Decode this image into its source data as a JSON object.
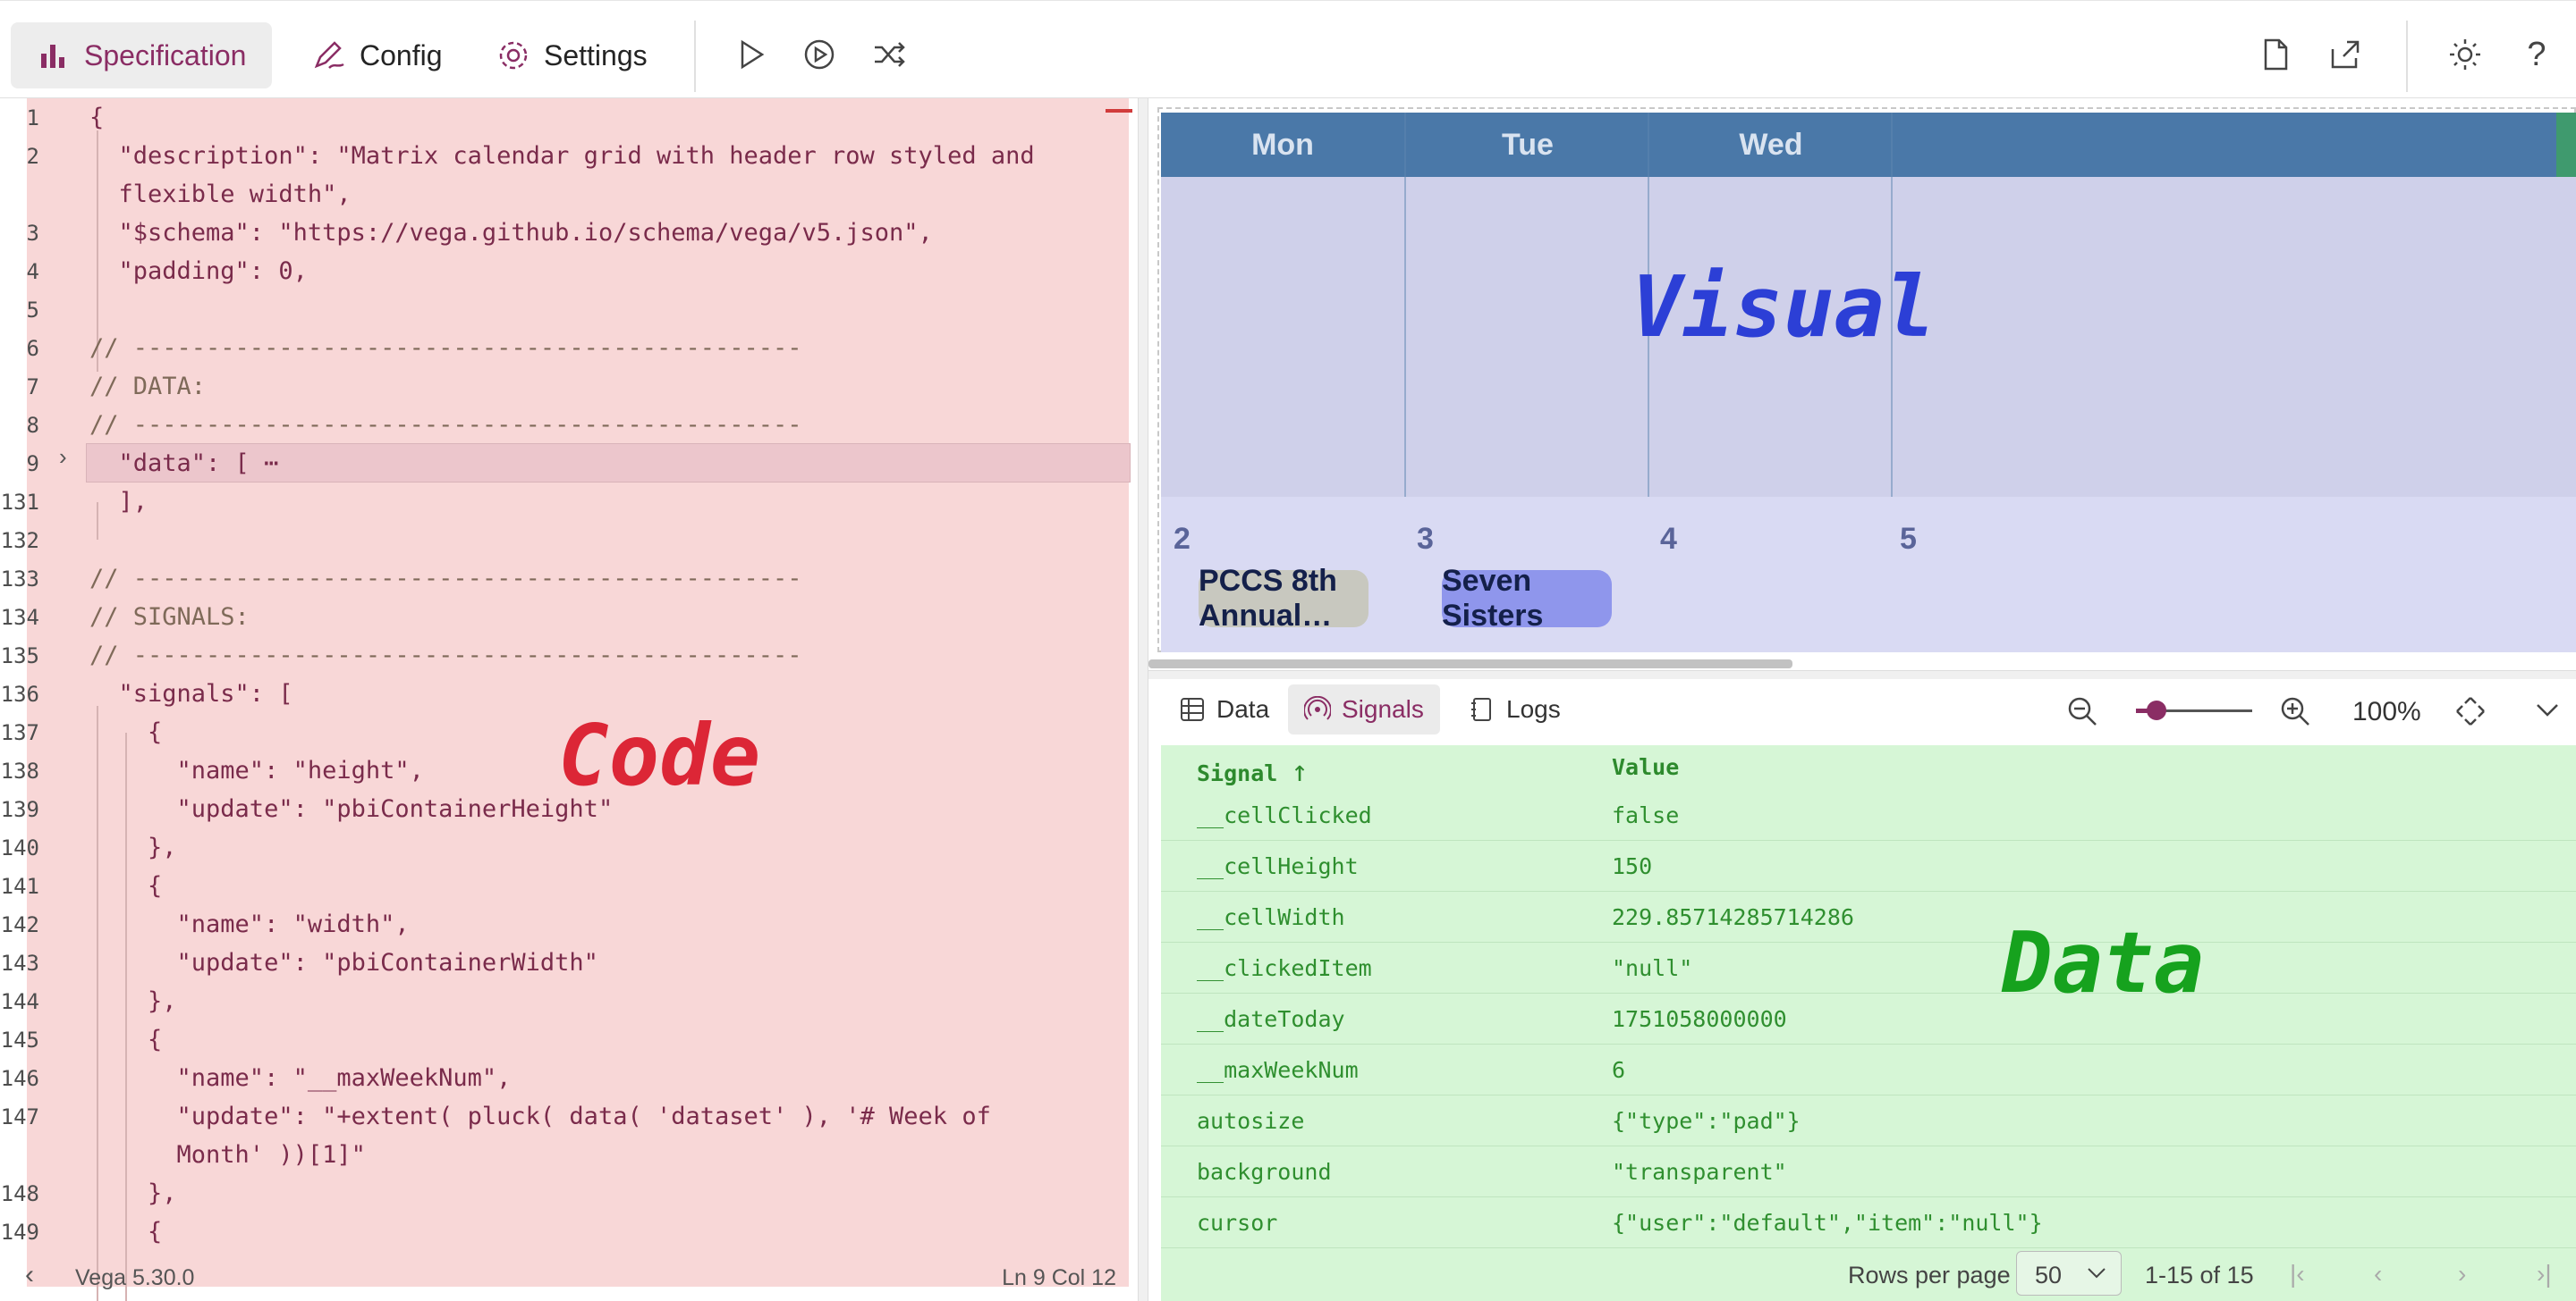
{
  "toolbar": {
    "tabs": [
      {
        "label": "Specification",
        "icon": "bar-chart-icon",
        "active": true
      },
      {
        "label": "Config",
        "icon": "pen-icon",
        "active": false
      },
      {
        "label": "Settings",
        "icon": "gear-icon",
        "active": false
      }
    ],
    "actions": [
      "play-icon",
      "replay-icon",
      "shuffle-icon"
    ],
    "right_actions": [
      "new-file-icon",
      "share-icon",
      "theme-sun-icon",
      "help-icon"
    ],
    "help_glyph": "?"
  },
  "editor": {
    "lines": [
      {
        "n": "1",
        "text": "{"
      },
      {
        "n": "2",
        "text": "  \"description\": \"Matrix calendar grid with header row styled and"
      },
      {
        "n": "",
        "text": "  flexible width\","
      },
      {
        "n": "3",
        "text": "  \"$schema\": \"https://vega.github.io/schema/vega/v5.json\","
      },
      {
        "n": "4",
        "text": "  \"padding\": 0,"
      },
      {
        "n": "5",
        "text": ""
      },
      {
        "n": "6",
        "text": "// ----------------------------------------------"
      },
      {
        "n": "7",
        "text": "// DATA:"
      },
      {
        "n": "8",
        "text": "// ----------------------------------------------"
      },
      {
        "n": "9",
        "text": "  \"data\": [ ⋯"
      },
      {
        "n": "131",
        "text": "  ],"
      },
      {
        "n": "132",
        "text": ""
      },
      {
        "n": "133",
        "text": "// ----------------------------------------------"
      },
      {
        "n": "134",
        "text": "// SIGNALS:"
      },
      {
        "n": "135",
        "text": "// ----------------------------------------------"
      },
      {
        "n": "136",
        "text": "  \"signals\": ["
      },
      {
        "n": "137",
        "text": "    {"
      },
      {
        "n": "138",
        "text": "      \"name\": \"height\","
      },
      {
        "n": "139",
        "text": "      \"update\": \"pbiContainerHeight\""
      },
      {
        "n": "140",
        "text": "    },"
      },
      {
        "n": "141",
        "text": "    {"
      },
      {
        "n": "142",
        "text": "      \"name\": \"width\","
      },
      {
        "n": "143",
        "text": "      \"update\": \"pbiContainerWidth\""
      },
      {
        "n": "144",
        "text": "    },"
      },
      {
        "n": "145",
        "text": "    {"
      },
      {
        "n": "146",
        "text": "      \"name\": \"__maxWeekNum\","
      },
      {
        "n": "147",
        "text": "      \"update\": \"+extent( pluck( data( 'dataset' ), '# Week of"
      },
      {
        "n": "",
        "text": "      Month' ))[1]\""
      },
      {
        "n": "148",
        "text": "    },"
      },
      {
        "n": "149",
        "text": "    {"
      }
    ],
    "overlay_label": "Code",
    "status": {
      "version": "Vega 5.30.0",
      "position": "Ln 9 Col 12"
    }
  },
  "visual": {
    "days": [
      "Mon",
      "Tue",
      "Wed"
    ],
    "dates": [
      "2",
      "3",
      "4",
      "5"
    ],
    "events": [
      "PCCS 8th Annual…",
      "Seven Sisters"
    ],
    "overlay_label": "Visual",
    "colors": {
      "header": "#4a78a8",
      "cell": "#cfd0ea",
      "event1": "#c8c8bf",
      "event2": "#8f96ec"
    }
  },
  "data_panel": {
    "tabs": [
      {
        "label": "Data",
        "icon": "table-icon"
      },
      {
        "label": "Signals",
        "icon": "signal-icon",
        "active": true
      },
      {
        "label": "Logs",
        "icon": "log-icon"
      }
    ],
    "zoom": "100%",
    "columns": {
      "signal": "Signal",
      "sort_glyph": "↑",
      "value": "Value"
    },
    "rows": [
      {
        "signal": "__cellClicked",
        "value": "false"
      },
      {
        "signal": "__cellHeight",
        "value": "150"
      },
      {
        "signal": "__cellWidth",
        "value": "229.85714285714286"
      },
      {
        "signal": "__clickedItem",
        "value": "\"null\""
      },
      {
        "signal": "__dateToday",
        "value": "1751058000000"
      },
      {
        "signal": "__maxWeekNum",
        "value": "6"
      },
      {
        "signal": "autosize",
        "value": "{\"type\":\"pad\"}"
      },
      {
        "signal": "background",
        "value": "\"transparent\""
      },
      {
        "signal": "cursor",
        "value": "{\"user\":\"default\",\"item\":\"null\"}"
      }
    ],
    "overlay_label": "Data",
    "pager": {
      "rows_per_page_label": "Rows per page",
      "rows_per_page": "50",
      "range": "1-15 of 15"
    }
  }
}
